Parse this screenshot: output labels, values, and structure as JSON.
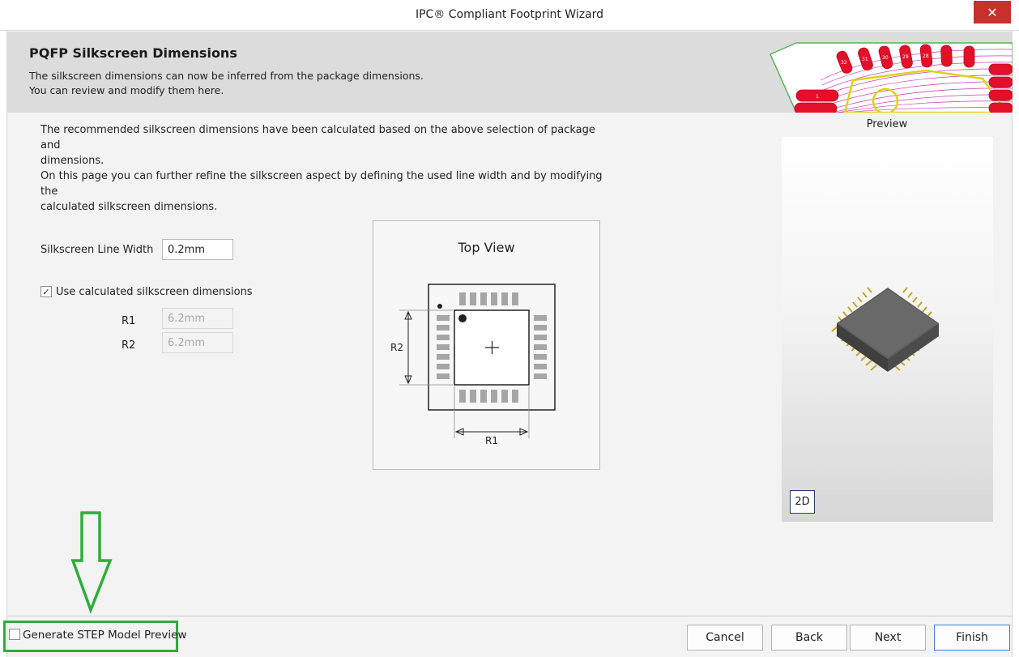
{
  "window": {
    "title": "IPC® Compliant Footprint Wizard",
    "close_glyph": "✕"
  },
  "header": {
    "title": "PQFP Silkscreen Dimensions",
    "line1": "The silkscreen dimensions can now be inferred from the package dimensions.",
    "line2": "You can review and modify them here.",
    "art_pin_labels": [
      "32",
      "31",
      "30",
      "29",
      "28",
      "1"
    ]
  },
  "description": {
    "line1": "The recommended silkscreen dimensions have been calculated based on the above selection of package and",
    "line2": "dimensions.",
    "line3": "On this page you can further refine the silkscreen aspect by defining the used line width and by modifying the",
    "line4": "calculated silkscreen dimensions."
  },
  "form": {
    "line_width_label": "Silkscreen Line Width",
    "line_width_value": "0.2mm",
    "use_calc_label": "Use calculated silkscreen dimensions",
    "use_calc_checked": true,
    "r1_label": "R1",
    "r1_value": "6.2mm",
    "r2_label": "R2",
    "r2_value": "6.2mm"
  },
  "topview": {
    "title": "Top View",
    "r1": "R1",
    "r2": "R2"
  },
  "preview": {
    "label": "Preview",
    "mode_button": "2D"
  },
  "footer": {
    "generate_step_label": "Generate STEP Model Preview",
    "generate_step_checked": false,
    "cancel": "Cancel",
    "back": "Back",
    "next": "Next",
    "finish": "Finish"
  },
  "colors": {
    "highlight": "#2ead3b",
    "close": "#c7302b",
    "pad_red": "#e3102a",
    "outline_magenta": "#cc3ab8",
    "accent_blue": "#3c7fd3"
  }
}
